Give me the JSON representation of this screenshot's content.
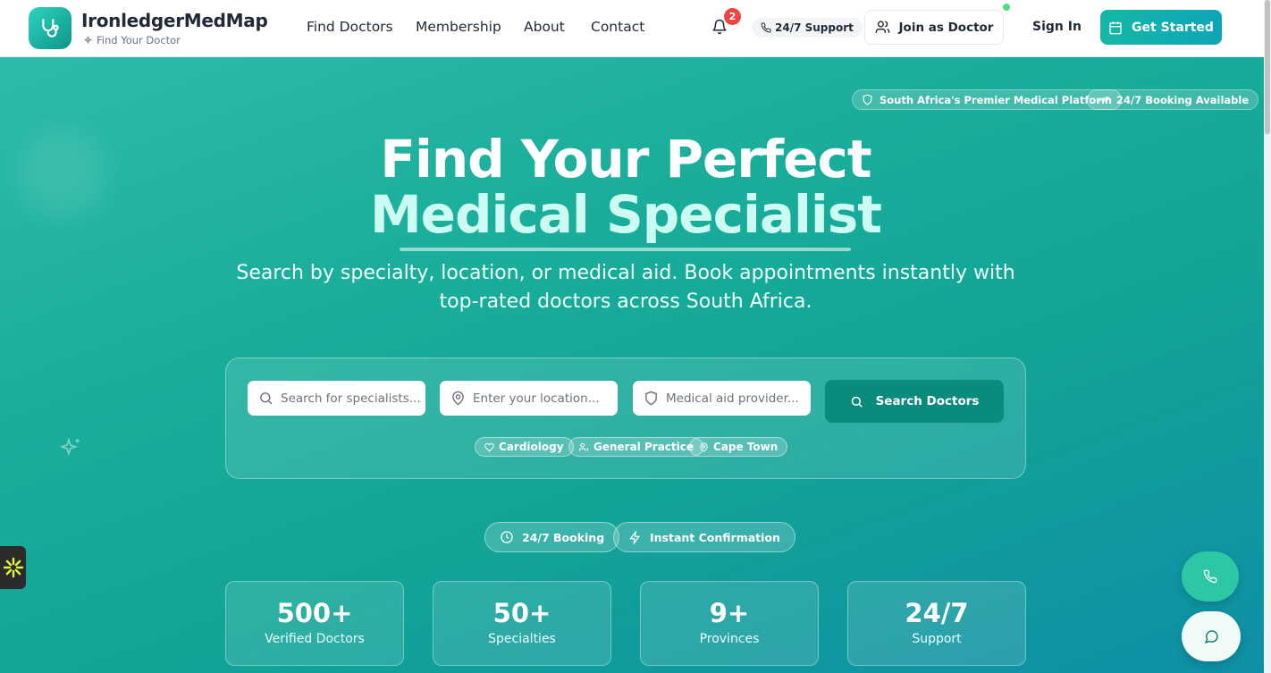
{
  "brand": {
    "name": "IronledgerMedMap",
    "tagline": "Find Your Doctor",
    "logo_icon": "stethoscope-icon",
    "accent": "#14b8a6"
  },
  "nav": {
    "links": [
      "Find Doctors",
      "Membership",
      "About",
      "Contact"
    ],
    "notification_count": "2",
    "support": "24/7 Support",
    "join": "Join as Doctor",
    "sign_in": "Sign In",
    "get_started": "Get Started"
  },
  "hero": {
    "badges": [
      "South Africa's Premier Medical Platform",
      "24/7 Booking Available"
    ],
    "title_line1": "Find Your Perfect",
    "title_line2": "Medical Specialist",
    "subtitle": "Search by specialty, location, or medical aid. Book appointments instantly with top-rated doctors across South Africa.",
    "colors": {
      "gradient_start": "#2dbba8",
      "gradient_end": "#0e8fa6"
    }
  },
  "search": {
    "specialist_placeholder": "Search for specialists...",
    "location_placeholder": "Enter your location...",
    "medical_aid_placeholder": "Medical aid provider...",
    "button": "Search Doctors",
    "quick_chips": [
      "Cardiology",
      "General Practice",
      "Cape Town"
    ]
  },
  "features": [
    "24/7 Booking",
    "Instant Confirmation"
  ],
  "stats": [
    {
      "value": "500+",
      "label": "Verified Doctors"
    },
    {
      "value": "50+",
      "label": "Specialties"
    },
    {
      "value": "9+",
      "label": "Provinces"
    },
    {
      "value": "24/7",
      "label": "Support"
    }
  ]
}
